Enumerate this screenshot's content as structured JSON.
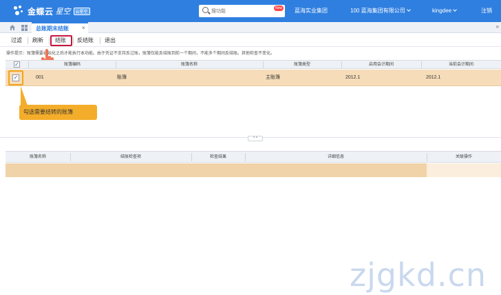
{
  "header": {
    "brand": "金蝶云",
    "brand_sub": "星空",
    "edition_badge": "云星空",
    "search_placeholder": "搜功能",
    "search_badge": "New",
    "org": "蓝海实业集团",
    "company": "100 蓝海集团有限公司",
    "user": "kingdee",
    "logout": "注销"
  },
  "tabs": [
    {
      "label": "总账期末结账",
      "close": "×"
    }
  ],
  "tab_overflow": "»",
  "toolbar": {
    "filter": "过滤",
    "refresh": "刷新",
    "close_period": "结账",
    "reverse_close": "反结账",
    "exit": "退出"
  },
  "hint": "操作提示：账簿需要初始化之后才能执行本功能。由于凭证不支持反过账，账簿仅能反结账到前一个期间，不能多个期间反结账。其他检查不变化。",
  "grid_top": {
    "select_all_mark": "✓",
    "columns": [
      "账簿编码",
      "账簿名称",
      "账簿类型",
      "启用会计期间",
      "当前会计期间"
    ],
    "rows": [
      {
        "checked": "✓",
        "code": "001",
        "name": "账簿",
        "type": "主账簿",
        "start": "2012.1",
        "current": "2012.1"
      }
    ]
  },
  "callout": "勾选需要结转的账簿",
  "splitter": {
    "label": "^ ^"
  },
  "grid_bottom": {
    "columns": [
      "账簿名称",
      "结账检查项",
      "检查结果",
      "详细信息",
      "关联操作"
    ]
  },
  "watermark": "zjgkd.cn",
  "colors": {
    "topbar": "#2f7fe0",
    "selected_row": "#f6dcb8",
    "highlight_border": "#c8163b",
    "callout": "#f4ad2a"
  }
}
